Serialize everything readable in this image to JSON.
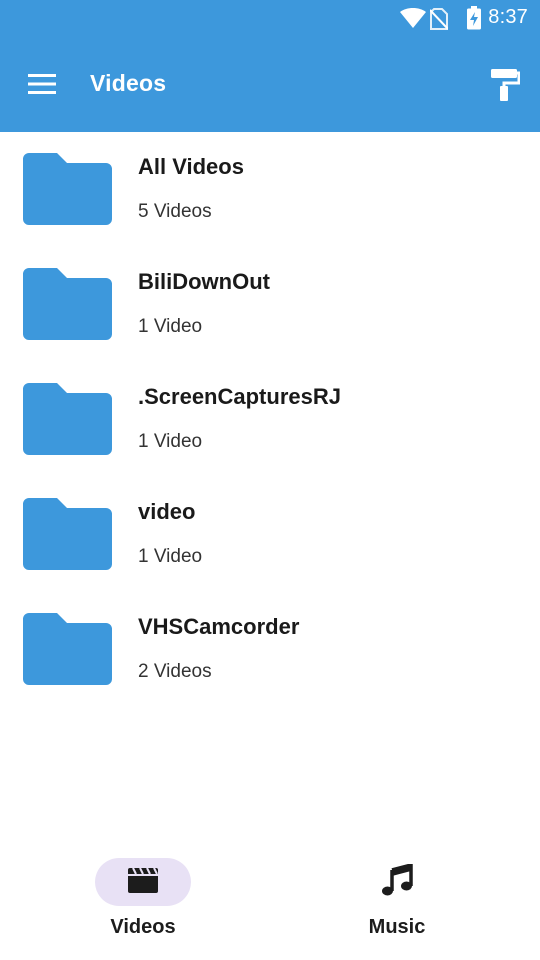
{
  "status_bar": {
    "time": "8:37",
    "icons": [
      "wifi-icon",
      "no-sim-icon",
      "battery-charging-icon"
    ]
  },
  "app_bar": {
    "title": "Videos",
    "menu_icon": "hamburger-menu-icon",
    "action_icon": "paint-roller-icon"
  },
  "folders": [
    {
      "name": "All Videos",
      "count": "5 Videos"
    },
    {
      "name": "BiliDownOut",
      "count": "1 Video"
    },
    {
      "name": ".ScreenCapturesRJ",
      "count": "1 Video"
    },
    {
      "name": "video",
      "count": "1 Video"
    },
    {
      "name": "VHSCamcorder",
      "count": "2 Videos"
    }
  ],
  "bottom_nav": {
    "tabs": [
      {
        "label": "Videos",
        "icon": "clapperboard-icon",
        "active": true
      },
      {
        "label": "Music",
        "icon": "music-note-icon",
        "active": false
      }
    ]
  },
  "colors": {
    "primary": "#3d98dc",
    "folder": "#3d98dc",
    "active_tab_pill": "#e8e1f5"
  }
}
